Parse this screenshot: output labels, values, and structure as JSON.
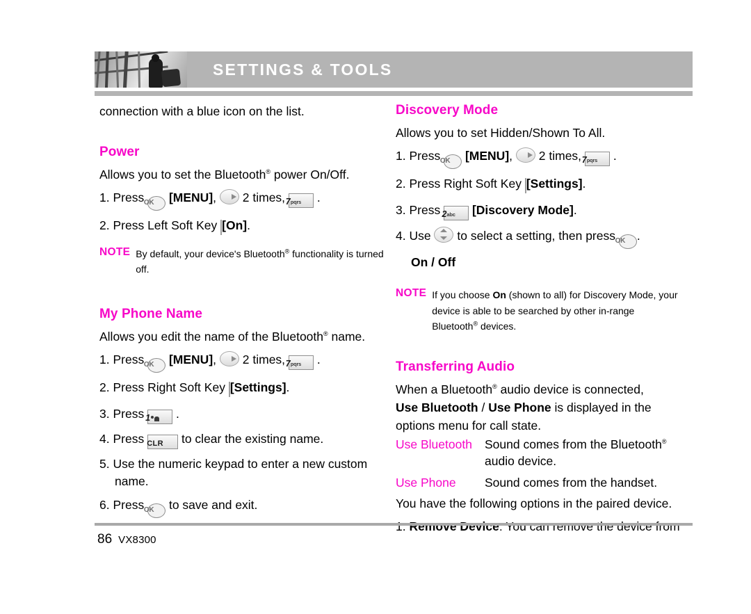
{
  "header": {
    "title": "SETTINGS & TOOLS",
    "thumbnail_alt": "grayscale-photo-scaffolding-person"
  },
  "left_column": {
    "carryover_text": "connection with a blue icon on the list.",
    "sections": [
      {
        "title": "Power",
        "intro_a": "Allows you to set the Bluetooth",
        "intro_b": " power On/Off.",
        "steps": [
          {
            "num": "1.",
            "parts": [
              "Press ",
              " [MENU], ",
              " 2 times, ",
              " ."
            ],
            "menu_label": "[MENU]",
            "times_label": "2 times,"
          },
          {
            "num": "2.",
            "prefix": "Press Left Soft Key ",
            "suffix": " [On].",
            "bracket_label": "[On]"
          }
        ],
        "note": {
          "label": "NOTE",
          "text_a": "By default, your device's Bluetooth",
          "text_b": " functionality is turned off."
        }
      },
      {
        "title": "My Phone Name",
        "intro_a": "Allows you edit the name of the Bluetooth",
        "intro_b": " name.",
        "steps": [
          {
            "num": "1.",
            "text": "Press  [MENU],  2 times,  7pqrs ."
          },
          {
            "num": "2.",
            "text": "Press Right Soft Key  [Settings]."
          },
          {
            "num": "3.",
            "text": "Press  1 ."
          },
          {
            "num": "4.",
            "text": "Press  CLR  to clear the existing name."
          },
          {
            "num": "5.",
            "text": "Use the numeric keypad to enter a new custom name."
          },
          {
            "num": "6.",
            "text": "Press  OK  to save and exit."
          }
        ]
      }
    ]
  },
  "right_column": {
    "sections": [
      {
        "title": "Discovery Mode",
        "intro": "Allows you to set Hidden/Shown To All.",
        "steps": [
          {
            "num": "1.",
            "text": "Press OK [MENU], right 2 times, 7pqrs ."
          },
          {
            "num": "2.",
            "text": "Press Right Soft Key [Settings]."
          },
          {
            "num": "3.",
            "text": "Press 2abc [Discovery Mode]."
          },
          {
            "num": "4.",
            "text": "Use updown to select a setting, then press OK."
          }
        ],
        "options_label": "On / Off",
        "note": {
          "label": "NOTE",
          "text_pre": "If you choose ",
          "text_bold": "On",
          "text_mid": " (shown to all) for Discovery Mode, your device is able to be searched by other in-range Bluetooth",
          "text_post": " devices."
        }
      },
      {
        "title": "Transferring Audio",
        "intro_a": "When a Bluetooth",
        "intro_b": " audio device is connected,",
        "intro_bold_a": "Use Bluetooth",
        "intro_slash": " / ",
        "intro_bold_b": "Use Phone",
        "intro_c": " is displayed in the",
        "intro_d": "options menu for call state.",
        "definitions": [
          {
            "term": "Use Bluetooth",
            "desc_a": "Sound comes from the Bluetooth",
            "desc_b": "",
            "desc_cont": "audio device."
          },
          {
            "term": "Use Phone",
            "desc_a": "Sound comes from the  handset.",
            "desc_b": "",
            "desc_cont": ""
          }
        ],
        "outro": "You have the following options in the paired device.",
        "options": [
          {
            "num": "1.",
            "bold": "Remove Device",
            "rest": ": You can remove the device from"
          }
        ]
      }
    ]
  },
  "labels": {
    "menu_bracket": "[MENU]",
    "two_times": "2 times,",
    "press": "Press",
    "use": "Use",
    "left_soft_key": "Press Left Soft Key",
    "right_soft_key": "Press Right Soft Key",
    "on_bracket": "[On]",
    "settings_bracket": "[Settings]",
    "discovery_bracket": "[Discovery Mode]",
    "clear_rest": "to clear the existing name.",
    "keypad_step": "Use the numeric keypad to enter a new custom name.",
    "save_rest": "to save and exit.",
    "select_rest": "to select a setting, then press",
    "period": ".",
    "comma": ","
  },
  "keys": {
    "ok": "OK",
    "seven_digit": "7",
    "seven_sub": "pqrs",
    "two_digit": "2",
    "two_sub": "abc",
    "one_digit": "1",
    "clr": "CLR"
  },
  "footer": {
    "page_number": "86",
    "model": "VX8300"
  },
  "colors": {
    "accent_magenta": "#f707c8",
    "header_gray": "#b4b4b4",
    "rule_gray": "#a9a9a9"
  }
}
